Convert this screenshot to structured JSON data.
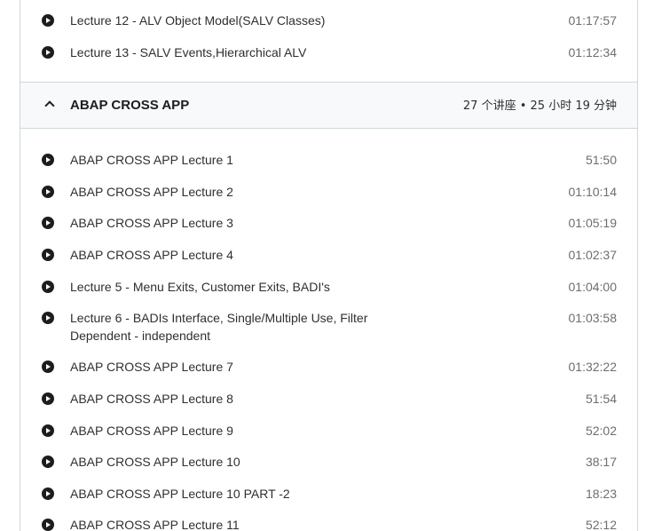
{
  "previous_lectures": [
    {
      "title": "Lecture 12 - ALV Object Model(SALV Classes)",
      "duration": "01:17:57"
    },
    {
      "title": "Lecture 13 - SALV Events,Hierarchical ALV",
      "duration": "01:12:34"
    }
  ],
  "section": {
    "title": "ABAP CROSS APP",
    "meta": "27 个讲座 • 25 小时 19 分钟",
    "expanded": true
  },
  "lectures": [
    {
      "title": "ABAP CROSS APP Lecture 1",
      "duration": "51:50"
    },
    {
      "title": "ABAP CROSS APP Lecture 2",
      "duration": "01:10:14"
    },
    {
      "title": "ABAP CROSS APP Lecture 3",
      "duration": "01:05:19"
    },
    {
      "title": "ABAP CROSS APP Lecture 4",
      "duration": "01:02:37"
    },
    {
      "title": "Lecture 5 - Menu Exits, Customer Exits, BADI's",
      "duration": "01:04:00"
    },
    {
      "title": "Lecture 6 - BADIs Interface, Single/Multiple Use, Filter Dependent - independent",
      "duration": "01:03:58"
    },
    {
      "title": "ABAP CROSS APP Lecture 7",
      "duration": "01:32:22"
    },
    {
      "title": "ABAP CROSS APP Lecture 8",
      "duration": "51:54"
    },
    {
      "title": "ABAP CROSS APP Lecture 9",
      "duration": "52:02"
    },
    {
      "title": "ABAP CROSS APP Lecture 10",
      "duration": "38:17"
    },
    {
      "title": "ABAP CROSS APP Lecture 10 PART -2",
      "duration": "18:23"
    },
    {
      "title": "ABAP CROSS APP Lecture 11",
      "duration": "52:12"
    }
  ],
  "icons": {
    "play": "play-circle-icon",
    "section_toggle": "chevron-up-icon"
  }
}
